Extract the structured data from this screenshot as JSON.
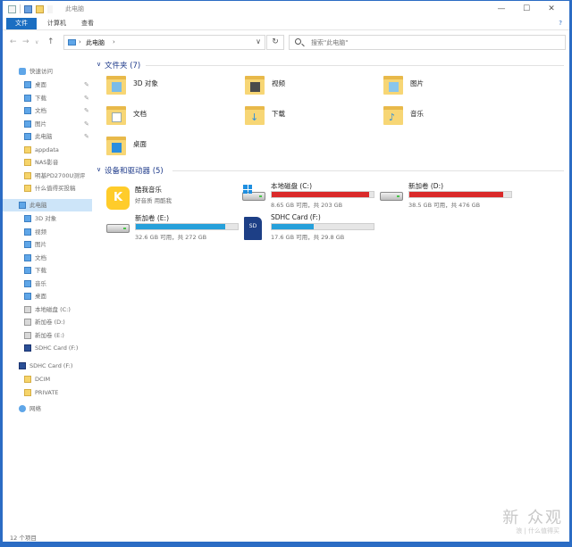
{
  "window": {
    "title": "此电脑",
    "controls": {
      "minimize": "—",
      "maximize": "☐",
      "close": "✕"
    }
  },
  "ribbon": {
    "tabs": [
      {
        "label": "文件"
      },
      {
        "label": "计算机"
      },
      {
        "label": "查看"
      }
    ],
    "help": "?"
  },
  "nav": {
    "back": "←",
    "forward": "→",
    "recent": "∨",
    "up": "↑",
    "address_crumb": "此电脑",
    "address_arrow": "›",
    "address_dropdown": "∨",
    "refresh": "↻",
    "search_placeholder": "搜索\"此电脑\""
  },
  "sidebar": {
    "quick_access": "快速访问",
    "items": [
      {
        "label": "桌面",
        "icon": "desktop-icon",
        "pinned": true
      },
      {
        "label": "下载",
        "icon": "download-icon",
        "pinned": true
      },
      {
        "label": "文档",
        "icon": "document-icon",
        "pinned": true
      },
      {
        "label": "图片",
        "icon": "picture-icon",
        "pinned": true
      },
      {
        "label": "此电脑",
        "icon": "pc-icon",
        "pinned": true
      },
      {
        "label": "appdata",
        "icon": "folder-icon"
      },
      {
        "label": "NAS影音",
        "icon": "folder-icon"
      },
      {
        "label": "明基PD2700U测评",
        "icon": "folder-icon"
      },
      {
        "label": "什么值得买投稿",
        "icon": "folder-icon"
      }
    ],
    "this_pc": "此电脑",
    "pc_items": [
      {
        "label": "3D 对象",
        "icon": "3d-objects-icon"
      },
      {
        "label": "视频",
        "icon": "video-icon"
      },
      {
        "label": "图片",
        "icon": "picture-icon"
      },
      {
        "label": "文档",
        "icon": "document-icon"
      },
      {
        "label": "下载",
        "icon": "download-icon"
      },
      {
        "label": "音乐",
        "icon": "music-icon"
      },
      {
        "label": "桌面",
        "icon": "desktop-icon"
      },
      {
        "label": "本地磁盘 (C:)",
        "icon": "drive-icon"
      },
      {
        "label": "新加卷 (D:)",
        "icon": "drive-icon"
      },
      {
        "label": "新加卷 (E:)",
        "icon": "drive-icon"
      },
      {
        "label": "SDHC Card (F:)",
        "icon": "sd-card-icon"
      }
    ],
    "sd_card": "SDHC Card (F:)",
    "sd_items": [
      {
        "label": "DCIM",
        "icon": "folder-icon"
      },
      {
        "label": "PRIVATE",
        "icon": "folder-icon"
      }
    ],
    "network": "网络"
  },
  "folders_group": {
    "title": "文件夹 (7)",
    "items": [
      {
        "label": "3D 对象",
        "badge": "3d"
      },
      {
        "label": "视频",
        "badge": "video"
      },
      {
        "label": "图片",
        "badge": "picture"
      },
      {
        "label": "文档",
        "badge": "document"
      },
      {
        "label": "下载",
        "badge": "download"
      },
      {
        "label": "音乐",
        "badge": "music"
      },
      {
        "label": "桌面",
        "badge": "desktop"
      }
    ]
  },
  "drives_group": {
    "title": "设备和驱动器 (5)",
    "app": {
      "name": "酷我音乐",
      "sub": "好音质 用酷我"
    },
    "drives": [
      {
        "label": "本地磁盘 (C:)",
        "size": "8.65 GB 可用，共 203 GB",
        "used_pct": 95.7,
        "color": "#da2a2a",
        "type": "windows"
      },
      {
        "label": "新加卷 (D:)",
        "size": "38.5 GB 可用，共 476 GB",
        "used_pct": 91.9,
        "color": "#da2a2a",
        "type": "hdd"
      },
      {
        "label": "新加卷 (E:)",
        "size": "32.6 GB 可用，共 272 GB",
        "used_pct": 88.0,
        "color": "#26a0da",
        "type": "hdd"
      },
      {
        "label": "SDHC Card (F:)",
        "size": "17.6 GB 可用，共 29.8 GB",
        "used_pct": 40.9,
        "color": "#26a0da",
        "type": "sd"
      }
    ]
  },
  "status": {
    "count": "12 个项目"
  },
  "watermark": {
    "main": "新 众观",
    "sub": "浪 | 什么值得买"
  }
}
